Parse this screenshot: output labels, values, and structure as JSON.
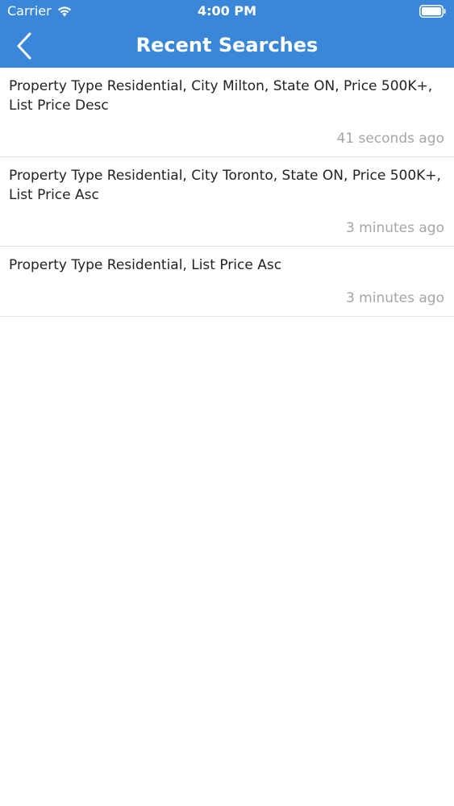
{
  "status_bar": {
    "carrier": "Carrier",
    "time": "4:00 PM"
  },
  "nav": {
    "title": "Recent Searches",
    "back_icon": "chevron-left-icon"
  },
  "colors": {
    "header": "#3a86d8",
    "timestamp": "#a6a6a6",
    "text": "#222222"
  },
  "searches": [
    {
      "text": "Property Type Residential, City Milton, State ON, Price 500K+, List Price Desc",
      "time": "41 seconds ago"
    },
    {
      "text": "Property Type Residential, City Toronto, State ON, Price 500K+, List Price Asc",
      "time": "3 minutes ago"
    },
    {
      "text": "Property Type Residential, List Price Asc",
      "time": "3 minutes ago"
    }
  ]
}
